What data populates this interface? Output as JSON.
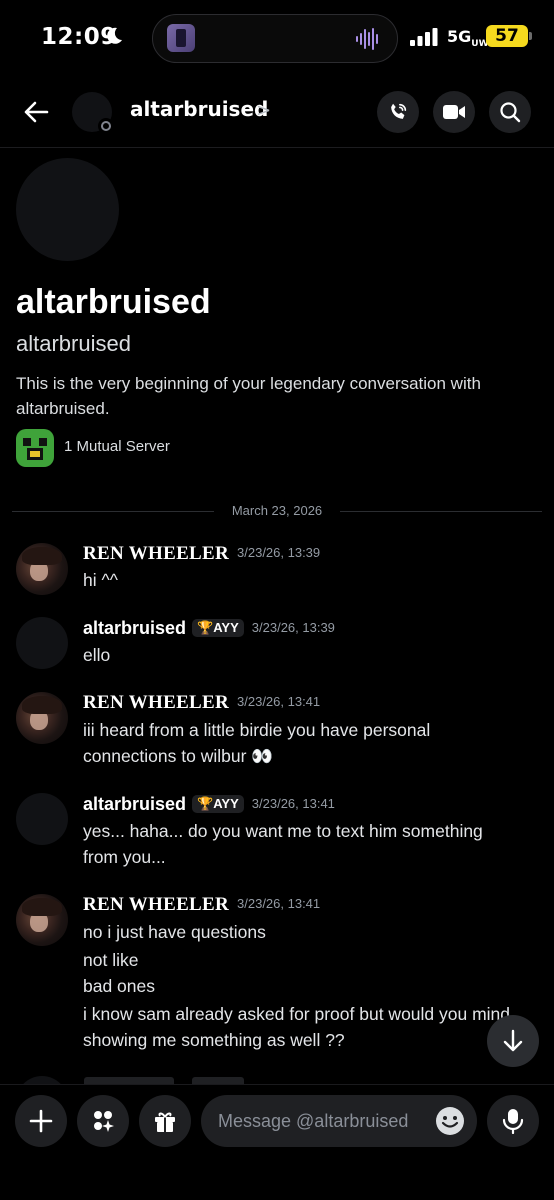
{
  "status_bar": {
    "time": "12:09",
    "network": "5G",
    "network_sub": "UW",
    "battery": "57"
  },
  "header": {
    "title": "altarbruised",
    "chevron": ">"
  },
  "intro": {
    "display_name": "altarbruised",
    "username": "altarbruised",
    "welcome": "This is the very beginning of your legendary conversation with altarbruised.",
    "mutual": "1 Mutual Server"
  },
  "date_divider": "March 23, 2026",
  "messages": [
    {
      "author": "REN WHEELER",
      "timestamp": "3/23/26, 13:39",
      "lines": [
        "hi ^^"
      ]
    },
    {
      "author": "altarbruised",
      "tag": "AYY",
      "timestamp": "3/23/26, 13:39",
      "lines": [
        "ello"
      ]
    },
    {
      "author": "REN WHEELER",
      "timestamp": "3/23/26, 13:41",
      "lines": [
        "iii heard from a little birdie you have personal",
        "connections to wilbur 👀"
      ]
    },
    {
      "author": "altarbruised",
      "tag": "AYY",
      "timestamp": "3/23/26, 13:41",
      "lines": [
        "yes... haha... do you want me to text him something",
        "from you..."
      ]
    },
    {
      "author": "REN WHEELER",
      "timestamp": "3/23/26, 13:41",
      "lines": [
        "no i just have questions",
        "not like",
        "bad ones",
        "i know sam already asked for proof but would you mind",
        "showing me something as well ??"
      ]
    }
  ],
  "composer": {
    "placeholder": "Message @altarbruised"
  },
  "colors": {
    "background": "#000000",
    "surface": "#1f2023",
    "muted_text": "#949ba4",
    "battery": "#f5d91e"
  }
}
